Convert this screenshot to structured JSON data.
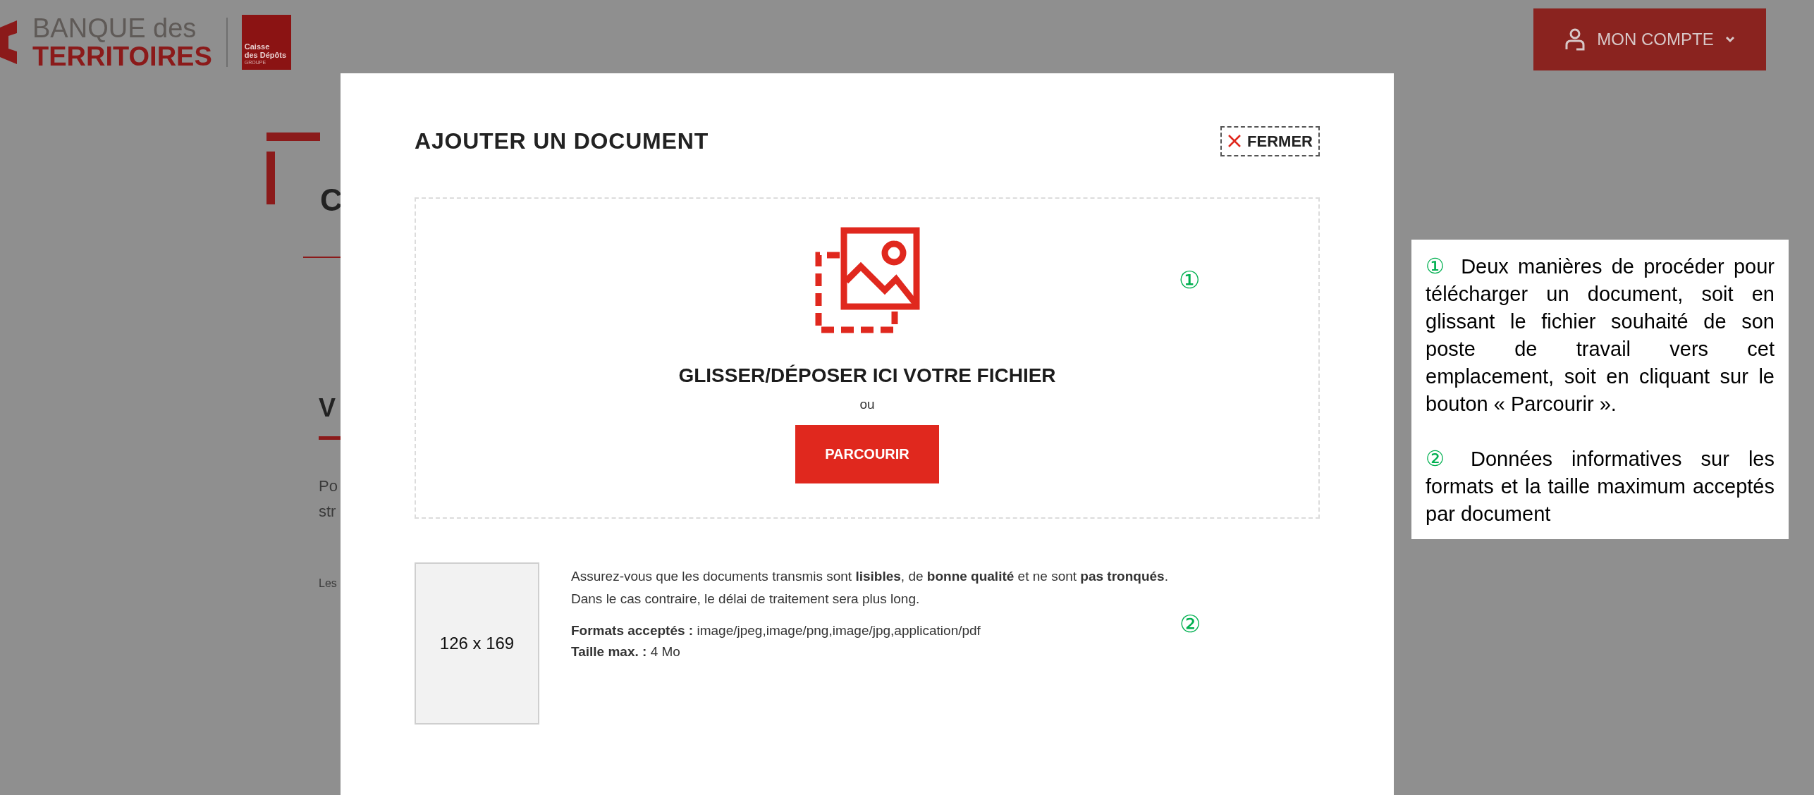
{
  "header": {
    "logo": {
      "line1": "BANQUE des",
      "line2": "TERRITOIRES",
      "badge_lines": [
        "Caisse",
        "des Dépôts",
        "GROUPE"
      ]
    },
    "account_button": "MON COMPTE"
  },
  "background_page": {
    "heading": "C",
    "section_title": "V",
    "paragraph_lines": [
      "Po",
      "str"
    ],
    "note": "Les"
  },
  "modal": {
    "title": "AJOUTER UN DOCUMENT",
    "close_button": "FERMER",
    "dropzone": {
      "heading": "GLISSER/DÉPOSER ICI VOTRE FICHIER",
      "separator": "ou",
      "browse_button": "PARCOURIR",
      "marker": "①"
    },
    "preview_placeholder": "126 x 169",
    "info_lines": [
      "Assurez-vous que les documents transmis sont **lisibles**, de **bonne qualité** et ne sont **pas tronqués**.",
      "Dans le cas contraire, le délai de traitement sera plus long."
    ],
    "format_lines": [
      "**Formats acceptés :** image/jpeg,image/png,image/jpg,application/pdf",
      "**Taille max. :** 4 Mo"
    ],
    "marker": "②"
  },
  "annotations": [
    {
      "marker": "①",
      "text": "Deux manières de procéder pour télécharger un document, soit en glissant le fichier souhaité de son poste de travail vers cet emplacement, soit en cliquant sur le bouton « Parcourir »."
    },
    {
      "marker": "②",
      "text": "Données informatives sur les formats et la taille maximum acceptés par document"
    }
  ]
}
